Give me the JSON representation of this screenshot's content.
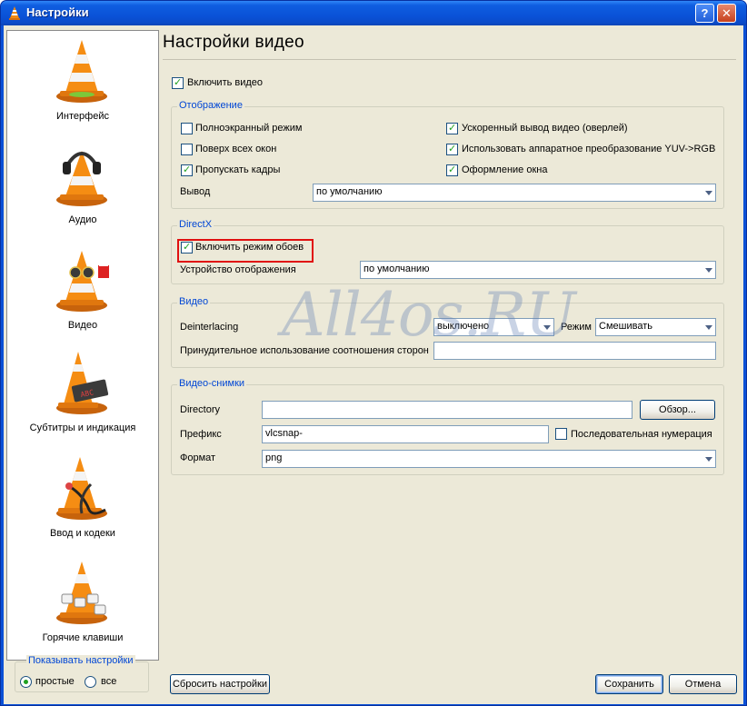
{
  "window": {
    "title": "Настройки",
    "help_label": "?",
    "close_label": "✕"
  },
  "sidebar": {
    "categories": [
      {
        "label": "Интерфейс",
        "icon": "vlc-cone-icon"
      },
      {
        "label": "Аудио",
        "icon": "vlc-cone-headphones-icon"
      },
      {
        "label": "Видео",
        "icon": "vlc-cone-glasses-icon"
      },
      {
        "label": "Субтитры и индикация",
        "icon": "vlc-cone-subtitles-icon"
      },
      {
        "label": "Ввод и кодеки",
        "icon": "vlc-cone-cables-icon"
      },
      {
        "label": "Горячие клавиши",
        "icon": "vlc-cone-keys-icon"
      }
    ],
    "show_settings": {
      "legend": "Показывать настройки",
      "simple": "простые",
      "all": "все",
      "selected": "простые"
    }
  },
  "main": {
    "heading": "Настройки видео",
    "enable_video": {
      "label": "Включить видео",
      "checked": true
    },
    "display": {
      "legend": "Отображение",
      "fullscreen": {
        "label": "Полноэкранный режим",
        "checked": false
      },
      "on_top": {
        "label": "Поверх всех окон",
        "checked": false
      },
      "skip_frames": {
        "label": "Пропускать кадры",
        "checked": true
      },
      "overlay": {
        "label": "Ускоренный вывод видео (оверлей)",
        "checked": true
      },
      "yuv_rgb": {
        "label": "Использовать аппаратное преобразование YUV->RGB",
        "checked": true
      },
      "decorations": {
        "label": "Оформление окна",
        "checked": true
      },
      "output_label": "Вывод",
      "output_value": "по умолчанию"
    },
    "directx": {
      "legend": "DirectX",
      "wallpaper": {
        "label": "Включить режим обоев",
        "checked": true
      },
      "device_label": "Устройство отображения",
      "device_value": "по умолчанию"
    },
    "video": {
      "legend": "Видео",
      "deinterlacing_label": "Deinterlacing",
      "deinterlacing_value": "выключено",
      "mode_label": "Режим",
      "mode_value": "Смешивать",
      "aspect_label": "Принудительное использование соотношения сторон",
      "aspect_value": ""
    },
    "snapshots": {
      "legend": "Видео-снимки",
      "directory_label": "Directory",
      "directory_value": "",
      "browse_label": "Обзор...",
      "prefix_label": "Префикс",
      "prefix_value": "vlcsnap-",
      "sequential": {
        "label": "Последовательная нумерация",
        "checked": false
      },
      "format_label": "Формат",
      "format_value": "png"
    }
  },
  "footer": {
    "reset_label": "Сбросить настройки",
    "save_label": "Сохранить",
    "cancel_label": "Отмена"
  },
  "watermark": "All4os.RU"
}
